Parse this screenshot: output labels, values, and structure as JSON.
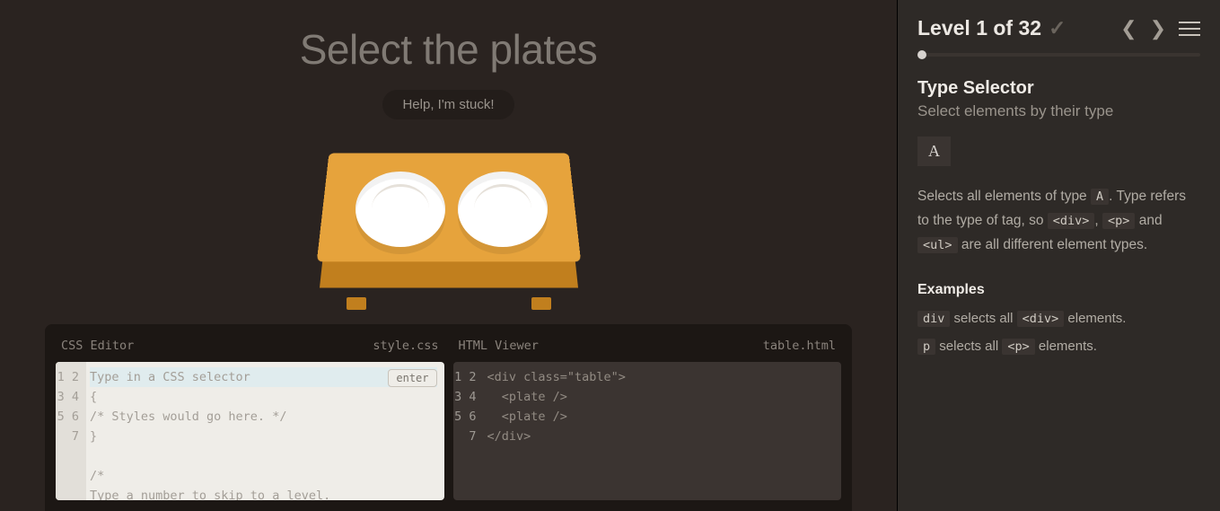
{
  "main": {
    "order": "Select the plates",
    "help_button": "Help, I'm stuck!"
  },
  "editor": {
    "css": {
      "title": "CSS Editor",
      "filename": "style.css",
      "enter_label": "enter",
      "lines": {
        "l1": "Type in a CSS selector",
        "l2": "{",
        "l3": "/* Styles would go here. */",
        "l4": "}",
        "l5": "",
        "l6": "/*",
        "l7": "Type a number to skip to a level."
      }
    },
    "html": {
      "title": "HTML Viewer",
      "filename": "table.html",
      "lines": {
        "l1": "<div class=\"table\">",
        "l2": "  <plate />",
        "l3": "  <plate />",
        "l4": "</div>"
      }
    }
  },
  "sidebar": {
    "level_label": "Level 1 of 32",
    "selector_title": "Type Selector",
    "selector_subtitle": "Select elements by their type",
    "syntax": "A",
    "help_pre": "Selects all elements of type ",
    "help_code1": "A",
    "help_mid1": ". Type refers to the type of tag, so ",
    "help_code2": "<div>",
    "help_sep1": ", ",
    "help_code3": "<p>",
    "help_sep2": " and ",
    "help_code4": "<ul>",
    "help_post": " are all different element types.",
    "examples_heading": "Examples",
    "ex1_code1": "div",
    "ex1_mid": " selects all ",
    "ex1_code2": "<div>",
    "ex1_post": " elements.",
    "ex2_code1": "p",
    "ex2_mid": " selects all ",
    "ex2_code2": "<p>",
    "ex2_post": " elements."
  }
}
